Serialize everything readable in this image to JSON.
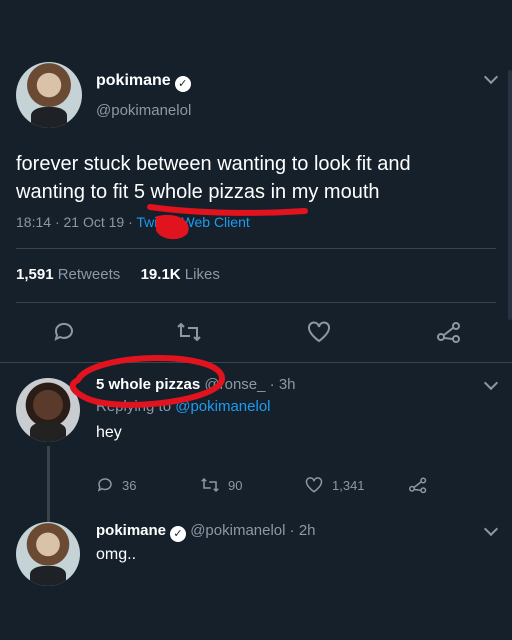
{
  "main_tweet": {
    "display_name": "pokimane",
    "handle": "@pokimanelol",
    "text_line1": "forever stuck between wanting to look fit and",
    "text_line2": "wanting to fit 5 whole pizzas in my mouth",
    "time": "18:14",
    "date": "21 Oct 19",
    "source": "Twitter Web Client",
    "retweets_count": "1,591",
    "retweets_label": "Retweets",
    "likes_count": "19.1K",
    "likes_label": "Likes"
  },
  "reply": {
    "display_name": "5 whole pizzas",
    "handle": "@ronse_",
    "time": "3h",
    "replying_to_label": "Replying to",
    "replying_to_handle": "@pokimanelol",
    "text": "hey",
    "reply_count": "36",
    "retweet_count": "90",
    "like_count": "1,341"
  },
  "reply2": {
    "display_name": "pokimane",
    "handle": "@pokimanelol",
    "time": "2h",
    "text": "omg.."
  },
  "colors": {
    "background": "#15202b",
    "accent": "#1d9bf0",
    "annotation": "#e0131f"
  },
  "icons": [
    "chevron-down-icon",
    "verified-icon",
    "reply-icon",
    "retweet-icon",
    "like-icon",
    "share-icon"
  ]
}
